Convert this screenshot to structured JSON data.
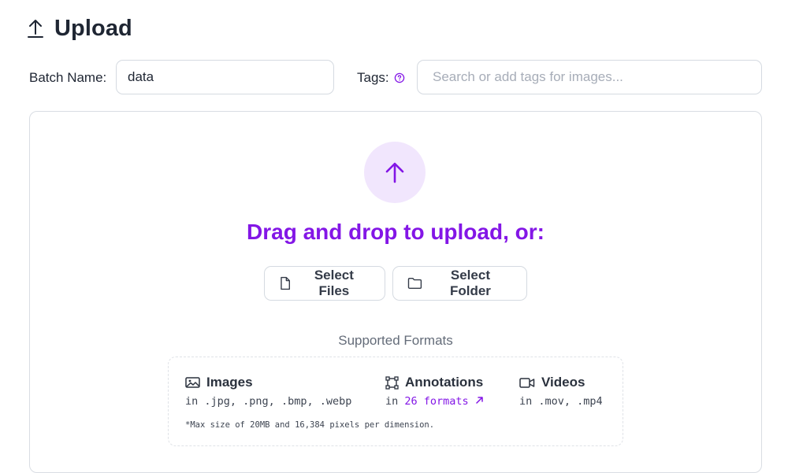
{
  "header": {
    "title": "Upload",
    "icon": "upload-icon"
  },
  "batch": {
    "label": "Batch Name:",
    "value": "data"
  },
  "tags": {
    "label": "Tags:",
    "placeholder": "Search or add tags for images...",
    "help_icon": "question-circle-icon"
  },
  "dropzone": {
    "title": "Drag and drop to upload, or:",
    "select_files_label": "Select Files",
    "select_folder_label": "Select Folder"
  },
  "formats": {
    "title": "Supported Formats",
    "images": {
      "label": "Images",
      "prefix": "in",
      "types": ".jpg, .png, .bmp, .webp"
    },
    "annotations": {
      "label": "Annotations",
      "prefix": "in",
      "link_text": "26 formats"
    },
    "videos": {
      "label": "Videos",
      "prefix": "in",
      "types": ".mov, .mp4"
    },
    "note": "*Max size of 20MB and 16,384 pixels per dimension."
  },
  "colors": {
    "accent": "#8316e6",
    "accent_soft": "#f1e6fd",
    "text": "#1f2633",
    "border": "#d5dae1"
  }
}
